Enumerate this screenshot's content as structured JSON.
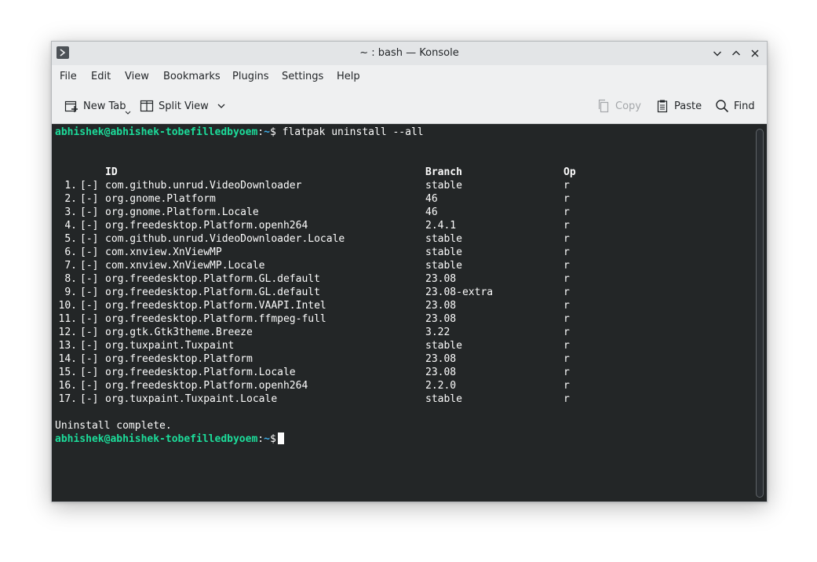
{
  "window": {
    "title": "~ : bash — Konsole",
    "controls": [
      "minimize-icon",
      "maximize-icon",
      "close-icon"
    ]
  },
  "menubar": {
    "items": [
      "File",
      "Edit",
      "View",
      "Bookmarks",
      "Plugins",
      "Settings",
      "Help"
    ]
  },
  "toolbar": {
    "new_tab": "New Tab",
    "split_view": "Split View",
    "copy": "Copy",
    "paste": "Paste",
    "find": "Find"
  },
  "terminal": {
    "prompt_user": "abhishek@abhishek-tobefilledbyoem",
    "prompt_sep": ":",
    "prompt_path": "~",
    "prompt_symbol": "$",
    "command": " flatpak uninstall --all",
    "headers": {
      "id": "ID",
      "branch": "Branch",
      "op": "Op"
    },
    "rows": [
      {
        "num": "1.",
        "box": "[-]",
        "id": "com.github.unrud.VideoDownloader",
        "branch": "stable",
        "op": "r"
      },
      {
        "num": "2.",
        "box": "[-]",
        "id": "org.gnome.Platform",
        "branch": "46",
        "op": "r"
      },
      {
        "num": "3.",
        "box": "[-]",
        "id": "org.gnome.Platform.Locale",
        "branch": "46",
        "op": "r"
      },
      {
        "num": "4.",
        "box": "[-]",
        "id": "org.freedesktop.Platform.openh264",
        "branch": "2.4.1",
        "op": "r"
      },
      {
        "num": "5.",
        "box": "[-]",
        "id": "com.github.unrud.VideoDownloader.Locale",
        "branch": "stable",
        "op": "r"
      },
      {
        "num": "6.",
        "box": "[-]",
        "id": "com.xnview.XnViewMP",
        "branch": "stable",
        "op": "r"
      },
      {
        "num": "7.",
        "box": "[-]",
        "id": "com.xnview.XnViewMP.Locale",
        "branch": "stable",
        "op": "r"
      },
      {
        "num": "8.",
        "box": "[-]",
        "id": "org.freedesktop.Platform.GL.default",
        "branch": "23.08",
        "op": "r"
      },
      {
        "num": "9.",
        "box": "[-]",
        "id": "org.freedesktop.Platform.GL.default",
        "branch": "23.08-extra",
        "op": "r"
      },
      {
        "num": "10.",
        "box": "[-]",
        "id": "org.freedesktop.Platform.VAAPI.Intel",
        "branch": "23.08",
        "op": "r"
      },
      {
        "num": "11.",
        "box": "[-]",
        "id": "org.freedesktop.Platform.ffmpeg-full",
        "branch": "23.08",
        "op": "r"
      },
      {
        "num": "12.",
        "box": "[-]",
        "id": "org.gtk.Gtk3theme.Breeze",
        "branch": "3.22",
        "op": "r"
      },
      {
        "num": "13.",
        "box": "[-]",
        "id": "org.tuxpaint.Tuxpaint",
        "branch": "stable",
        "op": "r"
      },
      {
        "num": "14.",
        "box": "[-]",
        "id": "org.freedesktop.Platform",
        "branch": "23.08",
        "op": "r"
      },
      {
        "num": "15.",
        "box": "[-]",
        "id": "org.freedesktop.Platform.Locale",
        "branch": "23.08",
        "op": "r"
      },
      {
        "num": "16.",
        "box": "[-]",
        "id": "org.freedesktop.Platform.openh264",
        "branch": "2.2.0",
        "op": "r"
      },
      {
        "num": "17.",
        "box": "[-]",
        "id": "org.tuxpaint.Tuxpaint.Locale",
        "branch": "stable",
        "op": "r"
      }
    ],
    "status": "Uninstall complete."
  },
  "colors": {
    "terminal_bg": "#232627",
    "terminal_fg": "#fcfcfc",
    "prompt_user": "#1cdc9a",
    "prompt_path": "#3daee9"
  }
}
